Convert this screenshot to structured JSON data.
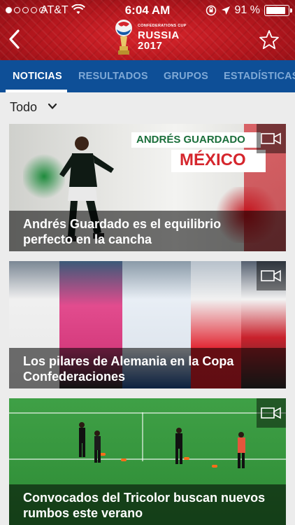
{
  "status_bar": {
    "carrier": "AT&T",
    "time": "6:04 AM",
    "battery": "91 %",
    "battery_level": 0.91
  },
  "header": {
    "logo_small": "CONFEDERATIONS CUP",
    "logo_country": "RUSSIA",
    "logo_year": "2017"
  },
  "tabs": [
    {
      "label": "NOTICIAS",
      "active": true
    },
    {
      "label": "RESULTADOS",
      "active": false
    },
    {
      "label": "GRUPOS",
      "active": false
    },
    {
      "label": "ESTADÍSTICAS",
      "active": false
    }
  ],
  "filter": {
    "label": "Todo"
  },
  "cards": [
    {
      "caption": "Andrés Guardado es el equilibrio perfecto en la cancha",
      "image_name": "ANDRÉS GUARDADO",
      "image_country": "MÉXICO"
    },
    {
      "caption": "Los pilares de Alemania en la Copa Confederaciones"
    },
    {
      "caption": "Convocados del Tricolor buscan nuevos rumbos este verano"
    }
  ],
  "colors": {
    "header_red": "#c41a22",
    "tab_bar_blue": "#0e4f97",
    "tab_inactive": "#7fa9d6",
    "mexico_green": "#1a6e3a",
    "mexico_red": "#d5262d"
  }
}
